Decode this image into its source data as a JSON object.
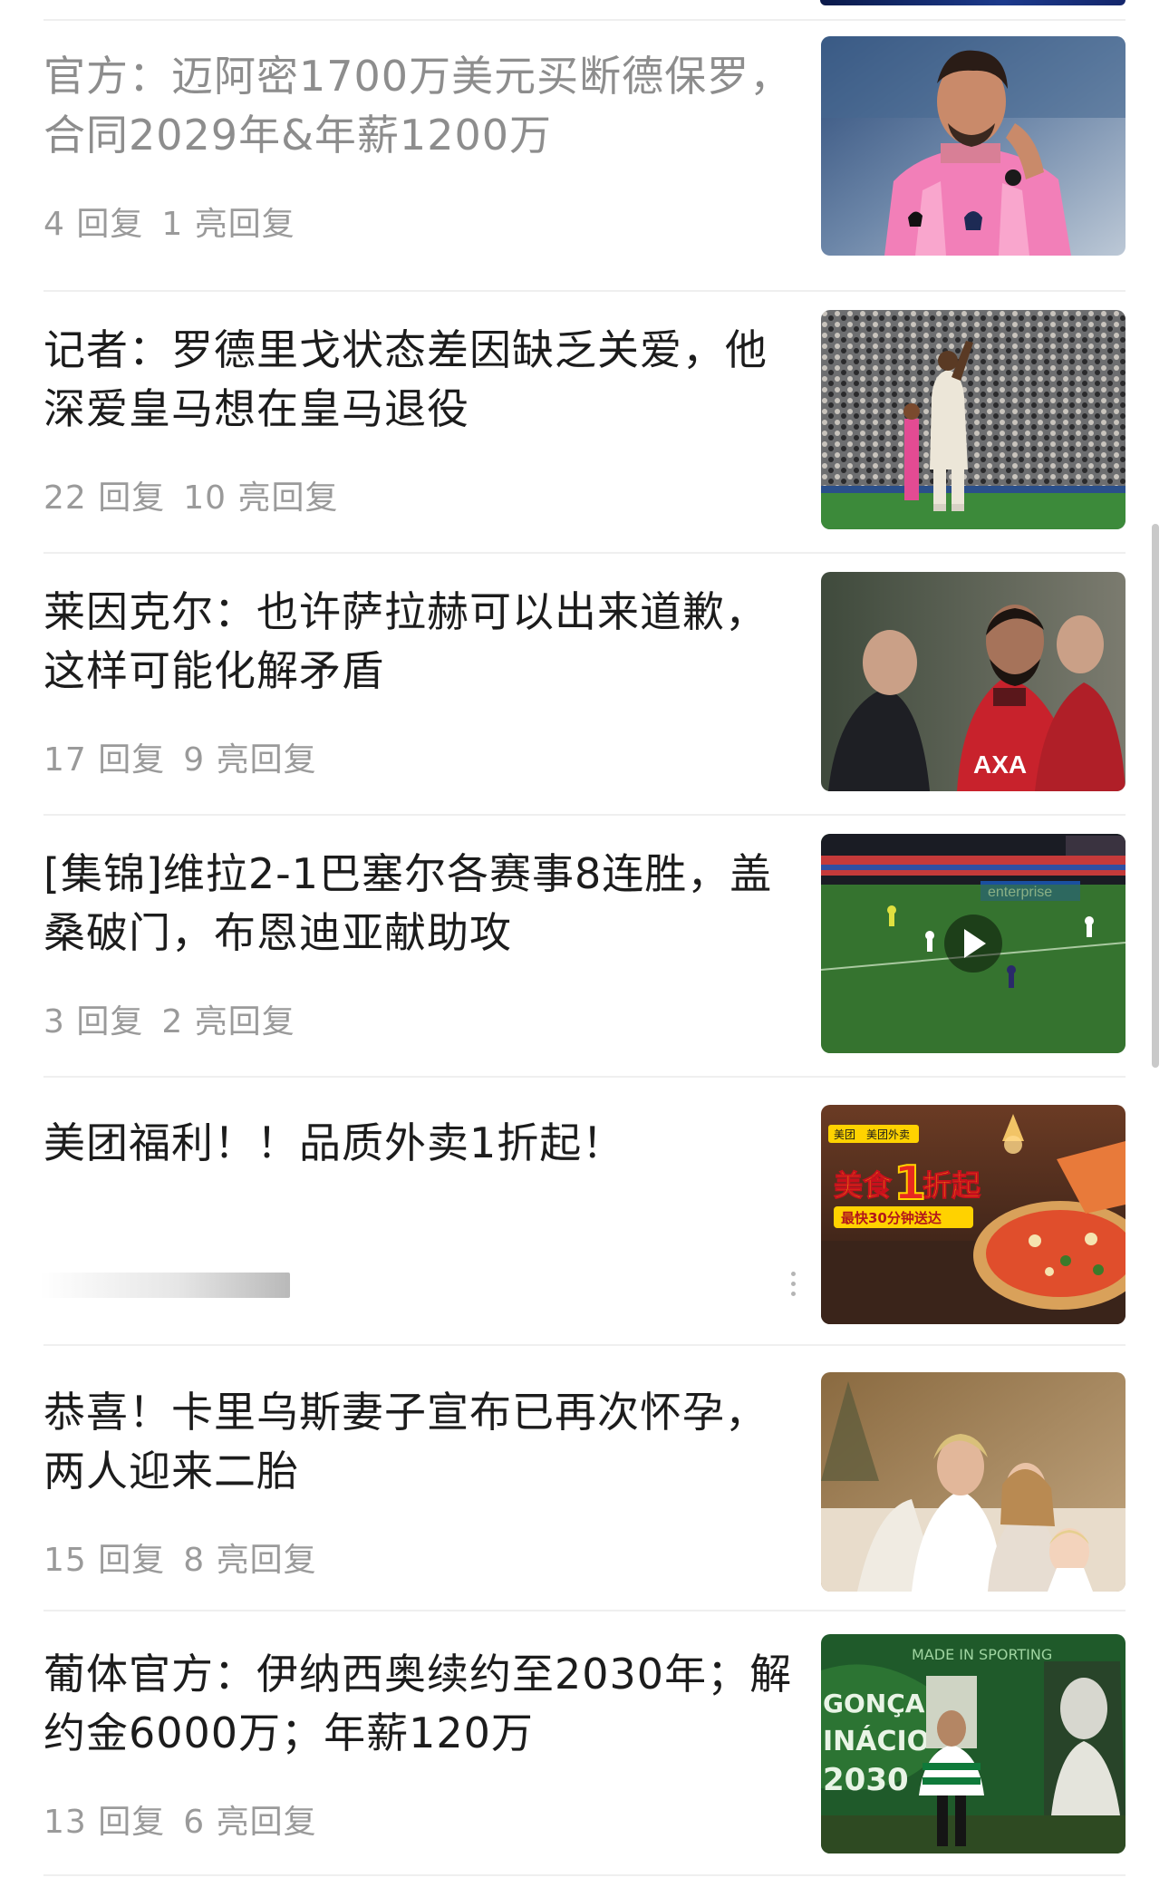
{
  "feed": {
    "items": [
      {
        "title": "官方：迈阿密1700万美元买断德保罗，合同2029年&年薪1200万",
        "replies": "4 回复",
        "lit_replies": "1 亮回复",
        "read": true
      },
      {
        "title": "记者：罗德里戈状态差因缺乏关爱，他深爱皇马想在皇马退役",
        "replies": "22 回复",
        "lit_replies": "10 亮回复",
        "read": false
      },
      {
        "title": "莱因克尔：也许萨拉赫可以出来道歉，这样可能化解矛盾",
        "replies": "17 回复",
        "lit_replies": "9 亮回复",
        "read": false
      },
      {
        "title": "[集锦]维拉2-1巴塞尔各赛事8连胜，盖桑破门，布恩迪亚献助攻",
        "replies": "3 回复",
        "lit_replies": "2 亮回复",
        "read": false
      },
      {
        "title": "美团福利！！品质外卖1折起！",
        "is_ad": true,
        "ad_badge_brand": "美团",
        "ad_badge_sub": "美团外卖",
        "ad_headline_a": "美食",
        "ad_headline_b": "1",
        "ad_headline_c": "折起",
        "ad_subline": "最快30分钟送达"
      },
      {
        "title": "恭喜！卡里乌斯妻子宣布已再次怀孕，两人迎来二胎",
        "replies": "15 回复",
        "lit_replies": "8 亮回复",
        "read": false
      },
      {
        "title": "葡体官方：伊纳西奥续约至2030年；解约金6000万；年薪120万",
        "replies": "13 回复",
        "lit_replies": "6 亮回复",
        "read": false
      }
    ]
  },
  "thumbnails": {
    "aston_villa_ad_board": "enterprise",
    "sporting_wall_line1": "MADE IN SPORTING",
    "sporting_wall_line2": "GONÇALO",
    "sporting_wall_line3": "INÁCIO",
    "sporting_wall_line4": "2030",
    "sponsor_text": "AXA"
  },
  "colors": {
    "title": "#1c1c1c",
    "title_read": "#8d8d8d",
    "meta": "#9a9a9a",
    "divider": "#efefef",
    "ad_red": "#e8281f",
    "ad_yellow": "#ffd200"
  }
}
